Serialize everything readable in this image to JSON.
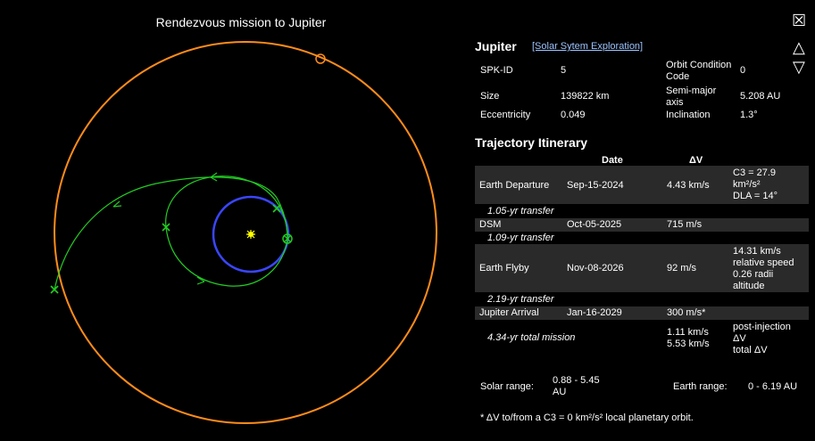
{
  "plot": {
    "title": "Rendezvous mission to Jupiter",
    "colors": {
      "jupiter_orbit": "#ff8c1a",
      "earth_orbit": "#3a46ff",
      "trajectory": "#22cc22",
      "sun": "#ffff00"
    }
  },
  "controls": {
    "close_icon": "☒",
    "up_icon": "△",
    "down_icon": "▽"
  },
  "body": {
    "name": "Jupiter",
    "link": "[Solar Sytem Exploration]",
    "props": [
      {
        "label": "SPK-ID",
        "value": "5"
      },
      {
        "label": "Orbit Condition Code",
        "value": "0"
      },
      {
        "label": "Size",
        "value": "139822 km"
      },
      {
        "label": "Semi-major axis",
        "value": "5.208 AU"
      },
      {
        "label": "Eccentricity",
        "value": "0.049"
      },
      {
        "label": "Inclination",
        "value": "1.3°"
      }
    ]
  },
  "itinerary": {
    "title": "Trajectory Itinerary",
    "headers": {
      "date": "Date",
      "dv": "ΔV"
    },
    "events": [
      {
        "event": "Earth Departure",
        "date": "Sep-15-2024",
        "dv": "4.43 km/s",
        "note_line1": "C3 = 27.9",
        "note_line2": "km²/s²",
        "note_line3": "DLA = 14°"
      },
      {
        "event": "DSM",
        "date": "Oct-05-2025",
        "dv": "715 m/s"
      },
      {
        "event": "Earth Flyby",
        "date": "Nov-08-2026",
        "dv": "92 m/s",
        "note_line1": "14.31 km/s",
        "note_line2": "relative speed",
        "note_line3": "0.26 radii",
        "note_line4": "altitude"
      },
      {
        "event": "Jupiter Arrival",
        "date": "Jan-16-2029",
        "dv": "300 m/s*"
      }
    ],
    "transfers": [
      "1.05-yr transfer",
      "1.09-yr transfer",
      "2.19-yr transfer"
    ],
    "total": {
      "label": "4.34-yr total mission",
      "dv1": "1.11 km/s",
      "dv2": "5.53 km/s",
      "dv1_label_a": "post-injection",
      "dv1_label_b": "ΔV",
      "dv2_label": "total ΔV"
    }
  },
  "ranges": {
    "solar_label": "Solar range:",
    "solar_value_a": "0.88 - 5.45",
    "solar_value_b": "AU",
    "earth_label": "Earth range:",
    "earth_value": "0 - 6.19 AU"
  },
  "footnote": "* ΔV to/from a C3 = 0 km²/s² local planetary orbit."
}
